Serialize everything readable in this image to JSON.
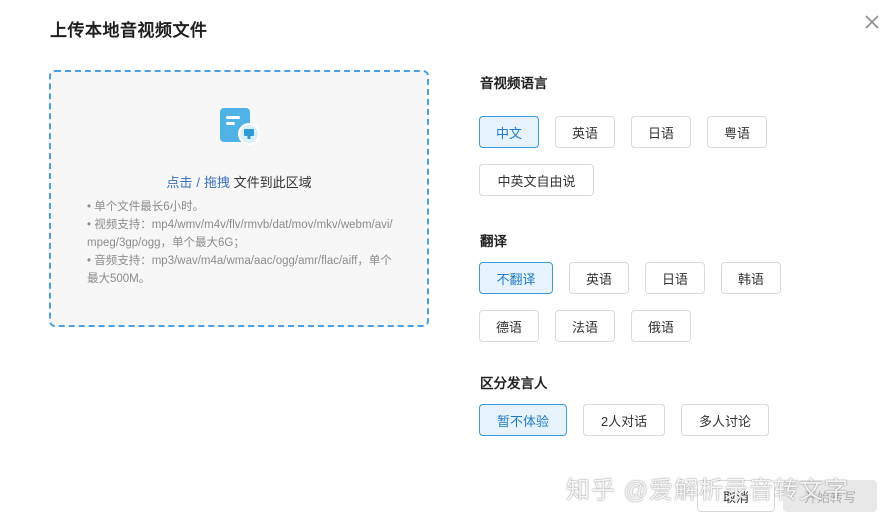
{
  "dialog": {
    "title": "上传本地音视频文件",
    "close_icon": "close-icon"
  },
  "upload": {
    "file_icon": "document-upload-icon",
    "click_link": "点击",
    "separator": "/",
    "drag_link": "拖拽",
    "hint_suffix": "文件到此区域",
    "notes": [
      "• 单个文件最长6小时。",
      "• 视频支持：mp4/wmv/m4v/flv/rmvb/dat/mov/mkv/webm/avi/mpeg/3gp/ogg，单个最大6G；",
      "• 音频支持：mp3/wav/m4a/wma/aac/ogg/amr/flac/aiff，单个最大500M。"
    ]
  },
  "language": {
    "label": "音视频语言",
    "options": [
      "中文",
      "英语",
      "日语",
      "粤语",
      "中英文自由说"
    ],
    "selected": "中文"
  },
  "translation": {
    "label": "翻译",
    "options": [
      "不翻译",
      "英语",
      "日语",
      "韩语",
      "德语",
      "法语",
      "俄语"
    ],
    "selected": "不翻译"
  },
  "speaker": {
    "label": "区分发言人",
    "options": [
      "暂不体验",
      "2人对话",
      "多人讨论"
    ],
    "selected": "暂不体验"
  },
  "footer": {
    "cancel_label": "取消",
    "start_label": "开始转写"
  },
  "watermark": "知乎 @爱解析录音转文字",
  "colors": {
    "accent": "#3b9be0",
    "selected_bg": "#e6f3fc",
    "dropzone_border": "#4aa0e6",
    "link": "#3b6fc1"
  }
}
